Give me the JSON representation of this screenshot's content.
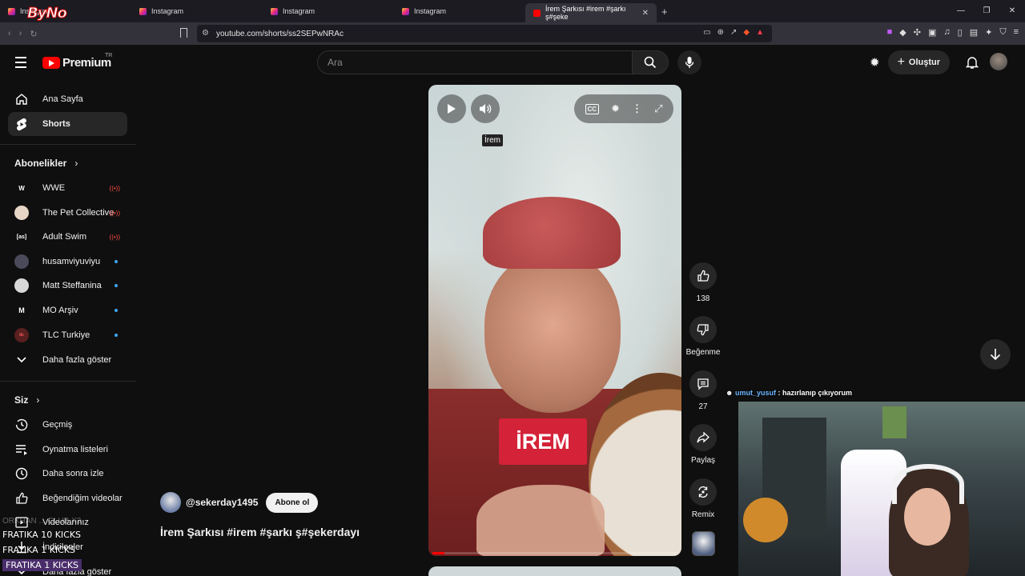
{
  "browser": {
    "tabs": [
      {
        "title": "Instagram"
      },
      {
        "title": "Instagram"
      },
      {
        "title": "Instagram"
      },
      {
        "title": "Instagram"
      },
      {
        "title": "İrem Şarkısı #irem #şarkı ş#şeke"
      }
    ],
    "url": "youtube.com/shorts/ss2SEPwNRAc",
    "overlay_logo": "ByNo"
  },
  "header": {
    "brand": "Premium",
    "region": "TR",
    "search_placeholder": "Ara",
    "create_label": "Oluştur"
  },
  "sidebar": {
    "main": [
      {
        "label": "Ana Sayfa",
        "icon": "home-icon"
      },
      {
        "label": "Shorts",
        "icon": "shorts-icon"
      }
    ],
    "subs_title": "Abonelikler",
    "subscriptions": [
      {
        "label": "WWE",
        "status": "live"
      },
      {
        "label": "The Pet Collective",
        "status": "live"
      },
      {
        "label": "Adult Swim",
        "status": "live"
      },
      {
        "label": "husamviyuviyu",
        "status": "new"
      },
      {
        "label": "Matt Steffanina",
        "status": "new"
      },
      {
        "label": "MO Arşiv",
        "status": "new"
      },
      {
        "label": "TLC Turkiye",
        "status": "new"
      }
    ],
    "show_more": "Daha fazla göster",
    "you_title": "Siz",
    "you_items": [
      {
        "label": "Geçmiş",
        "icon": "history-icon"
      },
      {
        "label": "Oynatma listeleri",
        "icon": "playlist-icon"
      },
      {
        "label": "Daha sonra izle",
        "icon": "clock-icon"
      },
      {
        "label": "Beğendiğim videolar",
        "icon": "like-icon"
      },
      {
        "label": "Videolarınız",
        "icon": "video-icon"
      },
      {
        "label": "İndirilenler",
        "icon": "download-icon"
      },
      {
        "label": "Daha fazla göster",
        "icon": "chevron-down-icon"
      }
    ]
  },
  "short": {
    "caption_tooltip": "İrem",
    "overlay_text": "İREM",
    "progress": 0.05,
    "channel": "@sekerday1495",
    "subscribe_label": "Abone ol",
    "title": "İrem Şarkısı #irem #şarkı ş#şekerdayı"
  },
  "actions": {
    "likes": "138",
    "dislike_label": "Beğenme",
    "comments": "27",
    "share_label": "Paylaş",
    "remix_label": "Remix"
  },
  "stream": {
    "chat_user": "umut_yusuf",
    "chat_message": " : hazırlanıp çıkıyorum",
    "ghost_text": "ORKHAN ... CLUB X3",
    "kicks": [
      "FRATIKA  10 KICKS",
      "FRATIKA  1 KICKS",
      "FRATIKA  1 KICKS"
    ]
  },
  "colors": {
    "accent": "#ff0000",
    "chip": "#272727",
    "background": "#0f0f0f"
  }
}
